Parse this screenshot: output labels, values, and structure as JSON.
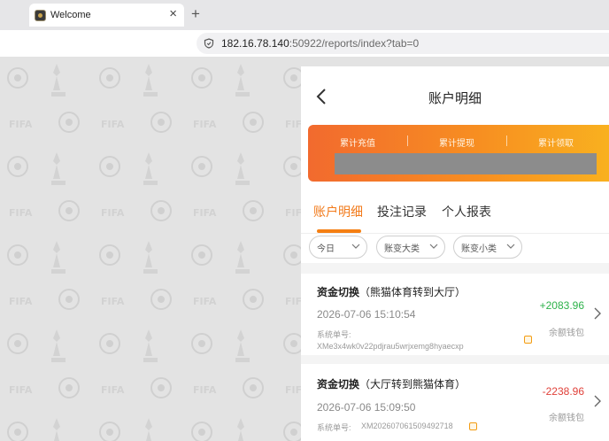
{
  "browser": {
    "tab_title": "Welcome",
    "close_glyph": "×",
    "new_tab_glyph": "+",
    "url_host": "182.16.78.140",
    "url_rest": ":50922/reports/index?tab=0"
  },
  "header": {
    "title": "账户明细",
    "back_icon": "chevron-left-icon"
  },
  "banner": {
    "labels": [
      "累计充值",
      "累计提现",
      "累计领取"
    ],
    "colors": [
      "#f26a2e",
      "#f9b21f"
    ]
  },
  "tabs": {
    "items": [
      "账户明细",
      "投注记录",
      "个人报表"
    ],
    "active_index": 0,
    "active_color": "#f27a1a"
  },
  "filters": [
    {
      "label": "今日"
    },
    {
      "label": "账变大类"
    },
    {
      "label": "账变小类"
    }
  ],
  "records": [
    {
      "type": "资金切换",
      "detail": "（熊猫体育转到大厅）",
      "time": "2026-07-06 15:10:54",
      "order_label": "系统单号:",
      "order_no": "XMe3x4wk0v22pdjrau5wrjxemg8hyaecxp",
      "amount": "+2083.96",
      "amount_color": "#2db24a",
      "wallet": "余额钱包"
    },
    {
      "type": "资金切换",
      "detail": "（大厅转到熊猫体育）",
      "time": "2026-07-06 15:09:50",
      "order_label": "系统单号:",
      "order_no": "XM202607061509492718",
      "amount": "-2238.96",
      "amount_color": "#e0413a",
      "wallet": "余额钱包"
    }
  ]
}
